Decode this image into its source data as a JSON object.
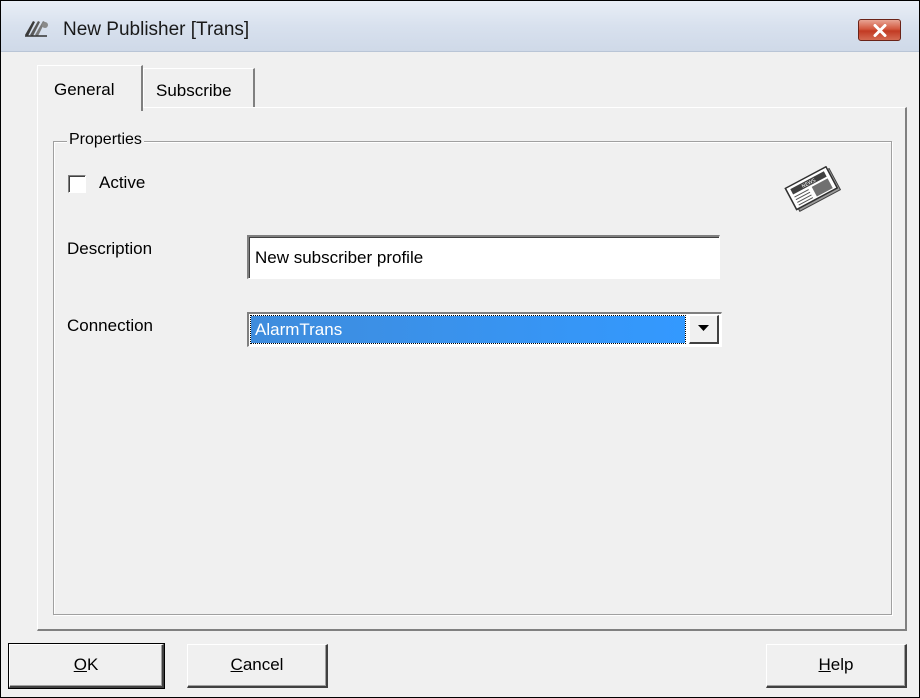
{
  "window": {
    "title": "New Publisher [Trans]"
  },
  "tabs": [
    {
      "label": "General",
      "selected": true
    },
    {
      "label": "Subscribe",
      "selected": false
    }
  ],
  "properties": {
    "group_label": "Properties",
    "active_label": "Active",
    "active_checked": false,
    "description_label": "Description",
    "description_value": "New subscriber profile",
    "connection_label": "Connection",
    "connection_value": "AlarmTrans",
    "icon": "newspaper-icon"
  },
  "buttons": {
    "ok_mnemonic": "O",
    "ok_rest": "K",
    "cancel_mnemonic": "C",
    "cancel_rest": "ancel",
    "help_mnemonic": "H",
    "help_rest": "elp"
  },
  "colors": {
    "selection": "#3399ff",
    "close_button": "#c23a23",
    "window_bg": "#f0f0f0"
  }
}
